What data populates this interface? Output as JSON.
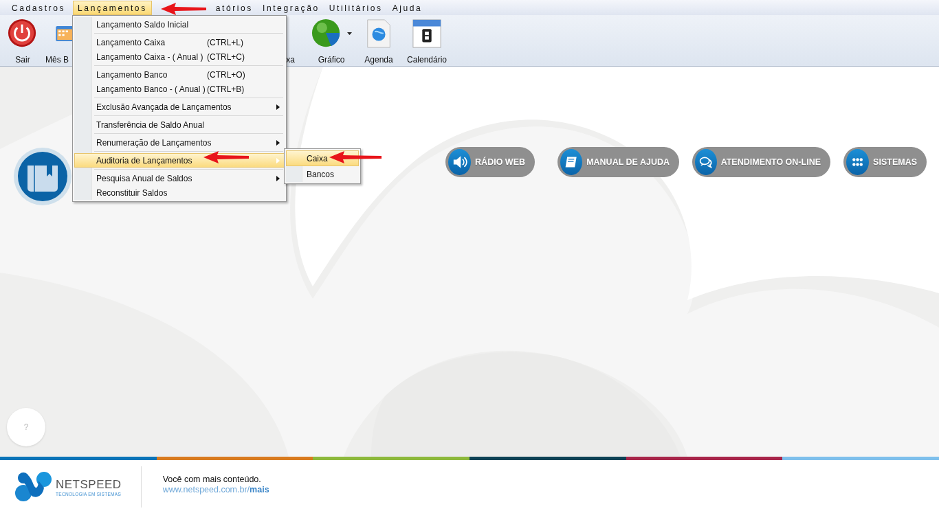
{
  "menubar": [
    {
      "label": "Cadastros",
      "selected": false
    },
    {
      "label": "Lançamentos",
      "selected": true
    },
    {
      "label": "atórios",
      "selected": false
    },
    {
      "label": "Integração",
      "selected": false
    },
    {
      "label": "Utilitários",
      "selected": false
    },
    {
      "label": "Ajuda",
      "selected": false
    }
  ],
  "toolbar": [
    {
      "label": "Sair",
      "kind": "power"
    },
    {
      "label": "Mês B",
      "kind": "month"
    },
    {
      "label": "xa",
      "kind": "cut"
    },
    {
      "label": "Gráfico",
      "kind": "chart",
      "dropdown": true
    },
    {
      "label": "Agenda",
      "kind": "globe"
    },
    {
      "label": "Calendário",
      "kind": "calendar"
    }
  ],
  "dropdown_menu": {
    "groups": [
      [
        {
          "label": "Lançamento Saldo Inicial",
          "has_submenu": false,
          "selected": false
        }
      ],
      [
        {
          "label": "Lançamento Caixa",
          "shortcut": "(CTRL+L)",
          "has_submenu": false,
          "selected": false
        },
        {
          "label": "Lançamento Caixa - ( Anual )",
          "shortcut": "(CTRL+C)",
          "has_submenu": false,
          "selected": false
        }
      ],
      [
        {
          "label": "Lançamento Banco",
          "shortcut": "(CTRL+O)",
          "has_submenu": false,
          "selected": false
        },
        {
          "label": "Lançamento Banco - ( Anual )",
          "shortcut": "(CTRL+B)",
          "has_submenu": false,
          "selected": false
        }
      ],
      [
        {
          "label": "Exclusão Avançada de Lançamentos",
          "has_submenu": true,
          "selected": false
        }
      ],
      [
        {
          "label": "Transferência de Saldo Anual",
          "has_submenu": false,
          "selected": false
        }
      ],
      [
        {
          "label": "Renumeração de Lançamentos",
          "has_submenu": true,
          "selected": false
        }
      ],
      [
        {
          "label": "Auditoria de Lançamentos",
          "has_submenu": true,
          "selected": true
        }
      ],
      [
        {
          "label": "Pesquisa Anual de Saldos",
          "has_submenu": true,
          "selected": false
        },
        {
          "label": "Reconstituir Saldos",
          "has_submenu": false,
          "selected": false
        }
      ]
    ]
  },
  "submenu": {
    "items": [
      {
        "label": "Caixa",
        "selected": true
      },
      {
        "label": "Bancos",
        "selected": false
      }
    ]
  },
  "quick_links": [
    {
      "label": "RÁDIO WEB",
      "kind": "speaker"
    },
    {
      "label": "MANUAL DE AJUDA",
      "kind": "book"
    },
    {
      "label": "ATENDIMENTO ON-LINE",
      "kind": "chat"
    },
    {
      "label": "SISTEMAS",
      "kind": "grid"
    }
  ],
  "help_button": {
    "label": "?"
  },
  "color_stripe": [
    {
      "color": "#0b74b8"
    },
    {
      "color": "#d97b1f"
    },
    {
      "color": "#8db93c"
    },
    {
      "color": "#0d4255"
    },
    {
      "color": "#a8264a"
    },
    {
      "color": "#7ec0ec"
    }
  ],
  "footer": {
    "brand": "NETSPEED",
    "tagline": "TECNOLOGIA EM SISTEMAS",
    "message": "Você com mais conteúdo.",
    "link": "www.netspeed.com.br/**mais**"
  }
}
